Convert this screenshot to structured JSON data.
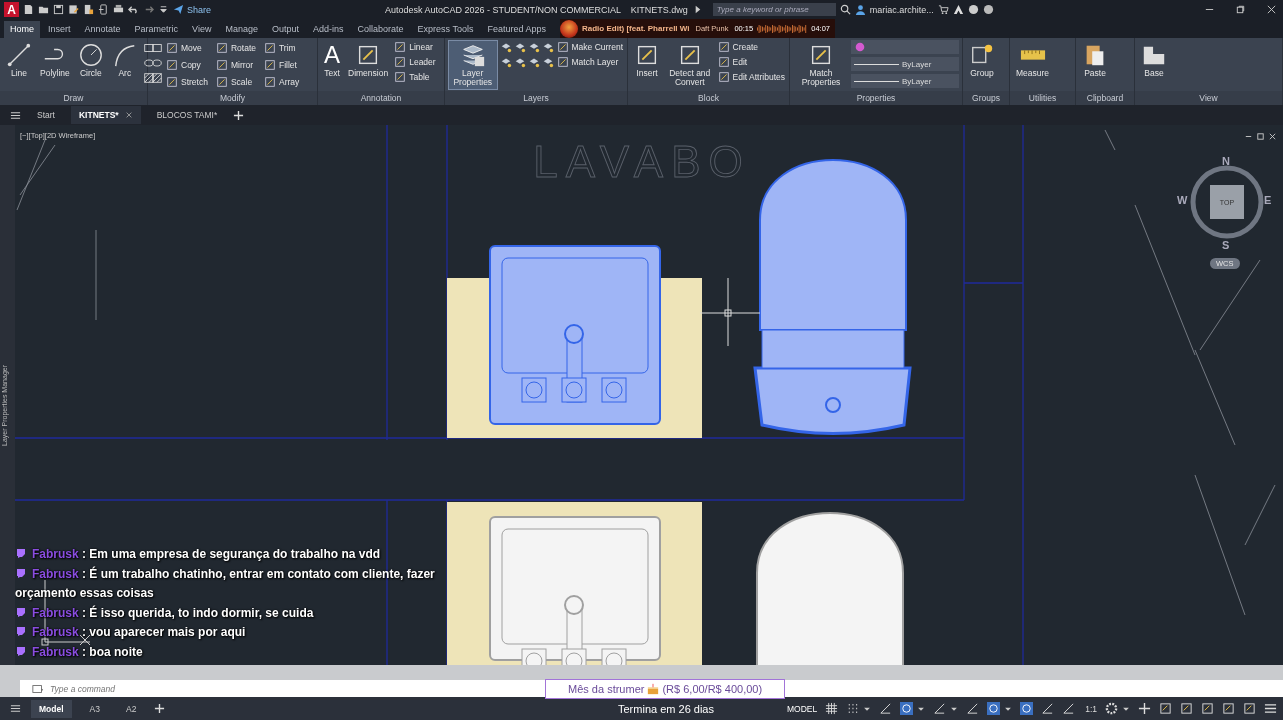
{
  "app_logo": "A",
  "quick_access": {
    "share": "Share"
  },
  "window": {
    "title": "Autodesk AutoCAD 2026 - STUDENT/NON COMMERCIAL    KITNETS.dwg"
  },
  "search": {
    "placeholder": "Type a keyword or phrase"
  },
  "user": {
    "name": "mariac.archite..."
  },
  "ribbon_tabs": [
    {
      "label": "Home",
      "selected": true
    },
    {
      "label": "Insert",
      "selected": false
    },
    {
      "label": "Annotate",
      "selected": false
    },
    {
      "label": "Parametric",
      "selected": false
    },
    {
      "label": "View",
      "selected": false
    },
    {
      "label": "Manage",
      "selected": false
    },
    {
      "label": "Output",
      "selected": false
    },
    {
      "label": "Add-ins",
      "selected": false
    },
    {
      "label": "Collaborate",
      "selected": false
    },
    {
      "label": "Express Tools",
      "selected": false
    },
    {
      "label": "Featured Apps",
      "selected": false
    }
  ],
  "ribbon_panels": [
    {
      "title": "Draw",
      "large": [
        {
          "label": "Line"
        },
        {
          "label": "Polyline"
        },
        {
          "label": "Circle"
        },
        {
          "label": "Arc"
        }
      ]
    },
    {
      "title": "Modify",
      "small": [
        "Move",
        "Copy",
        "Stretch",
        "Rotate",
        "Mirror",
        "Scale",
        "Trim",
        "Fillet",
        "Array"
      ]
    },
    {
      "title": "Annotation",
      "large": [
        {
          "label": "Text",
          "glyph": "A"
        },
        {
          "label": "Dimension"
        }
      ],
      "small": [
        "Linear",
        "Leader",
        "Table"
      ]
    },
    {
      "title": "Layers",
      "large": [
        {
          "label": "Layer Properties"
        }
      ],
      "small": [
        "Make Current",
        "Match Layer"
      ]
    },
    {
      "title": "Block",
      "large": [
        {
          "label": "Insert"
        },
        {
          "label": "Detect and Convert"
        }
      ],
      "small": [
        "Create",
        "Edit",
        "Edit Attributes"
      ]
    },
    {
      "title": "Properties",
      "large": [
        {
          "label": "Match Properties"
        }
      ],
      "dropdowns": [
        "ByLayer",
        "ByLayer"
      ]
    },
    {
      "title": "Groups",
      "large": [
        {
          "label": "Group"
        }
      ]
    },
    {
      "title": "Utilities",
      "large": [
        {
          "label": "Measure"
        }
      ]
    },
    {
      "title": "Clipboard",
      "large": [
        {
          "label": "Paste"
        }
      ]
    },
    {
      "title": "View",
      "large": [
        {
          "label": "Base"
        }
      ]
    }
  ],
  "doc_tabs": [
    {
      "label": "Start",
      "selected": false
    },
    {
      "label": "KITNETS*",
      "selected": true
    },
    {
      "label": "BLOCOS TAMI*",
      "selected": false
    }
  ],
  "viewport_label": "[−][Top][2D Wireframe]",
  "drawing": {
    "title": "LAVABO",
    "fixtures": [
      {
        "kind": "sink",
        "selected": true
      },
      {
        "kind": "toilet",
        "selected": true
      },
      {
        "kind": "sink",
        "selected": false
      },
      {
        "kind": "toilet",
        "selected": false
      }
    ]
  },
  "view_cube": {
    "north": "N",
    "south": "S",
    "east": "E",
    "west": "W",
    "face": "TOP",
    "ucs": "WCS"
  },
  "side_palette": {
    "label": "Layer Properties Manager"
  },
  "command_line": {
    "placeholder": "Type a command"
  },
  "layout_tabs": [
    {
      "label": "Model",
      "selected": true
    },
    {
      "label": "A3",
      "selected": false
    },
    {
      "label": "A2",
      "selected": false
    }
  ],
  "status_bar": {
    "mode": "MODEL",
    "scale": "1:1"
  },
  "music_player": {
    "title": "Radio Edit) [feat. Pharrell Wi",
    "artist": "Daft Punk",
    "elapsed": "00:15",
    "duration": "04:07"
  },
  "chat": [
    {
      "user": "Fabrusk",
      "text": ": Em uma empresa de segurança do trabalho na vdd"
    },
    {
      "user": "Fabrusk",
      "text": ": É um trabalho chatinho, entrar em contato com cliente, fazer orçamento essas coisas"
    },
    {
      "user": "Fabrusk",
      "text": ": É isso querida, to indo dormir, se cuida"
    },
    {
      "user": "Fabrusk",
      "text": ": vou aparecer mais por aqui"
    },
    {
      "user": "Fabrusk",
      "text": ": boa noite"
    }
  ],
  "sub_goal": {
    "label": "Mês da strumer",
    "amount": "(R$ 6,00/R$ 400,00)",
    "ends": "Termina em 26 dias"
  }
}
